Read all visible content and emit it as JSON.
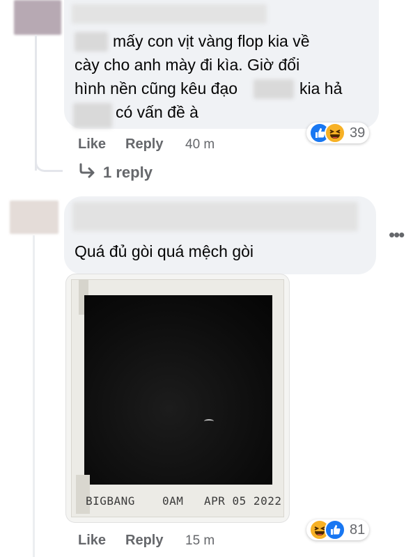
{
  "comment1": {
    "text_lines": [
      "mấy con vịt vàng flop kia về",
      "cày cho anh mày đi kìa. Giờ đổi",
      "hình nền cũng kêu đạo",
      "kia hả",
      "có vấn đề à"
    ],
    "actions": {
      "like": "Like",
      "reply": "Reply",
      "time": "40 m"
    },
    "reactions": {
      "types": [
        "like-icon",
        "haha-icon"
      ],
      "count": "39"
    },
    "replies_link": "1 reply"
  },
  "comment2": {
    "text": "Quá đủ gòi quá mệch gòi",
    "photo": {
      "caption_left": "BIGBANG",
      "caption_mid": "0AM",
      "caption_right": "APR 05 2022"
    },
    "actions": {
      "like": "Like",
      "reply": "Reply",
      "time": "15 m"
    },
    "reactions": {
      "types": [
        "haha-icon",
        "like-icon"
      ],
      "count": "81"
    },
    "more_icon": "more-options-icon"
  },
  "colors": {
    "bubble": "#f0f2f5",
    "secondary_text": "#65676b",
    "like_blue": "#1877f2",
    "haha_yellow": "#f7b125"
  }
}
